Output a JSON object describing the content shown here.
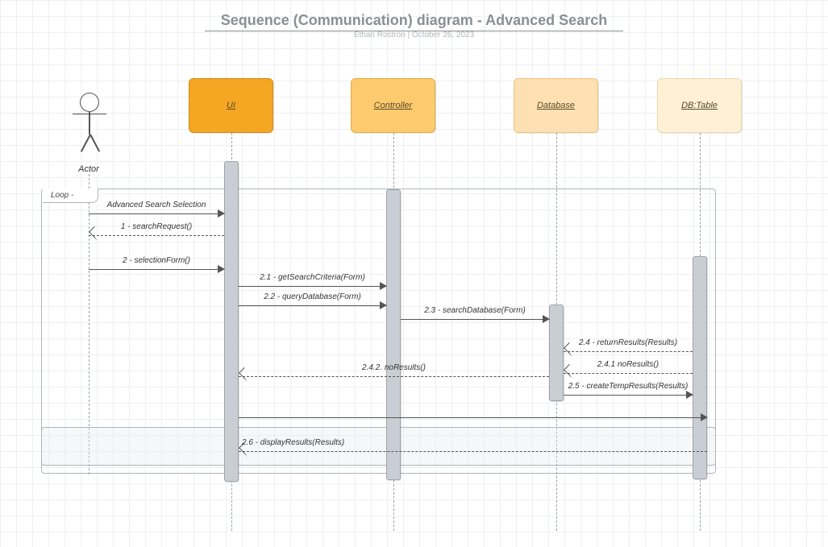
{
  "title": "Sequence (Communication) diagram - Advanced Search",
  "subtitle": "Ethan Rostron  |  October 26, 2023",
  "actor_label": "Actor",
  "loop_label": "Loop -",
  "lifelines": {
    "ui": "UI",
    "controller": "Controller",
    "database": "Database",
    "dbtable": "DB:Table"
  },
  "messages": {
    "m0": "Advanced Search Selection",
    "m1": "1 - searchRequest()",
    "m2": "2 - selectionForm()",
    "m21": "2.1 - getSearchCriteria(Form)",
    "m22": "2.2 - queryDatabase(Form)",
    "m23": "2.3 - searchDatabase(Form)",
    "m24": "2.4 - returnResults(Results)",
    "m241": "2.4.1 noResults()",
    "m242": "2.4.2. noResults()",
    "m25": "2.5 - createTempResults(Results)",
    "m26": "2.6 - displayResults(Results)"
  }
}
